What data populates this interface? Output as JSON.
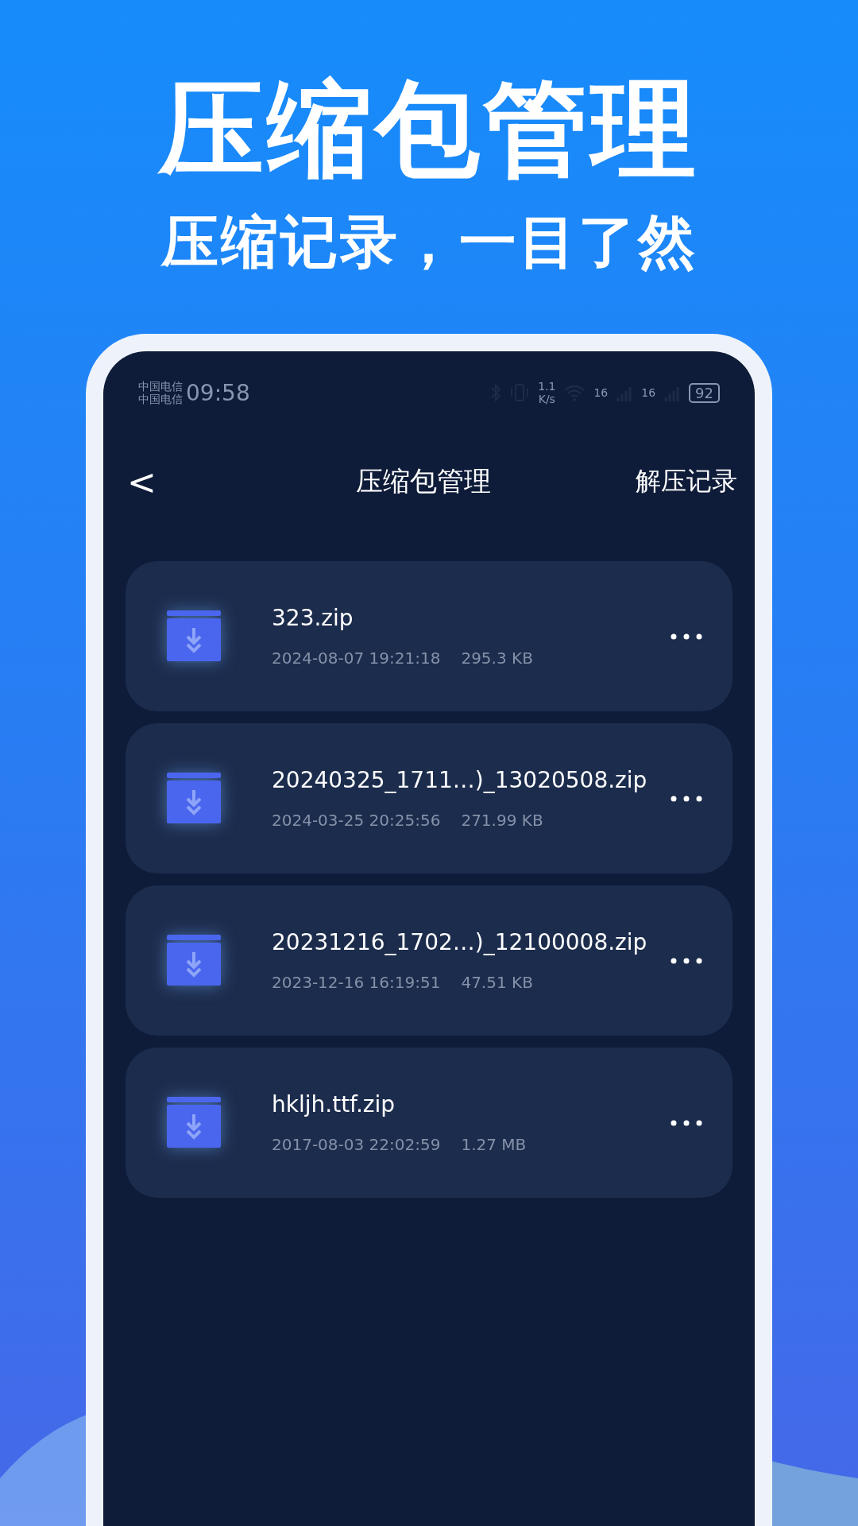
{
  "headline": "压缩包管理",
  "subheadline": "压缩记录，一目了然",
  "status_bar": {
    "carriers": [
      "中国电信",
      "中国电信"
    ],
    "time": "09:58",
    "speed": [
      "1.1",
      "K/s"
    ],
    "signal_labels": [
      "16",
      "16"
    ],
    "battery": "92"
  },
  "nav": {
    "back": "<",
    "title": "压缩包管理",
    "action": "解压记录"
  },
  "files": [
    {
      "name": "323.zip",
      "date": "2024-08-07 19:21:18",
      "size": "295.3 KB"
    },
    {
      "name": "20240325_1711…)_13020508.zip",
      "date": "2024-03-25 20:25:56",
      "size": "271.99 KB"
    },
    {
      "name": "20231216_1702…)_12100008.zip",
      "date": "2023-12-16 16:19:51",
      "size": "47.51 KB"
    },
    {
      "name": "hkljh.ttf.zip",
      "date": "2017-08-03 22:02:59",
      "size": "1.27 MB"
    }
  ]
}
